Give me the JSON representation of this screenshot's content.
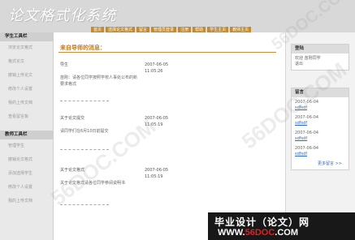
{
  "header": {
    "title": "论文格式化系统",
    "nav": [
      "首页",
      "选择论文格式",
      "留言",
      "管理员登录",
      "注册",
      "帮助",
      "学生主页",
      "教师主页"
    ]
  },
  "left_sidebar": {
    "sections": [
      {
        "title": "学生工具栏",
        "items": [
          "浏览论文格式",
          "格式论文",
          "撤销上传论文",
          "修改个人设置",
          "我的上传文档",
          "查看留言板"
        ]
      },
      {
        "title": "教师工具栏",
        "items": [
          "管理学生",
          "撤销论文格式",
          "添加选择学生",
          "修改个人设置",
          "我的上传文档"
        ]
      }
    ]
  },
  "main": {
    "title": "来自导师的消息：",
    "news": [
      {
        "title": "导生",
        "date": "2007-06-05",
        "time": "11:05:26",
        "desc": "苗刚：请各位同学按照学校人事处公布的新要求格式"
      },
      {
        "title": "关于论文提交",
        "date": "2007-06-05",
        "time": "11:05:19",
        "desc": "请同学们在6月10日前提交"
      },
      {
        "title": "关于论文格式",
        "date": "2007-06-05",
        "time": "11:05:19",
        "desc": "关于论文格式请各位同学参阅说明书"
      }
    ],
    "separator": "- - - - - - - - - - - - - - -"
  },
  "right_sidebar": {
    "login": {
      "title": "登陆",
      "line1": "欢迎 苗刚同学",
      "line2": "退出"
    },
    "replies": {
      "title": "留言",
      "items": [
        {
          "date": "2007-06-04",
          "user": "sdfsdf"
        },
        {
          "date": "2007-06-04",
          "user": "sdfsdf"
        },
        {
          "date": "2007-06-04",
          "user": "sdfsdf"
        },
        {
          "date": "2007-06-04",
          "user": "sdfsdf"
        }
      ],
      "more": "更多留言 >>"
    }
  },
  "footer": {
    "line1": "毕业设计（论文）网",
    "line2_prefix": "WWW.",
    "line2_red": "56DOC",
    "line2_suffix": ".COM"
  },
  "watermarks": [
    "56DOC.COM",
    "56DOC.COM",
    "56DOC.COM"
  ]
}
